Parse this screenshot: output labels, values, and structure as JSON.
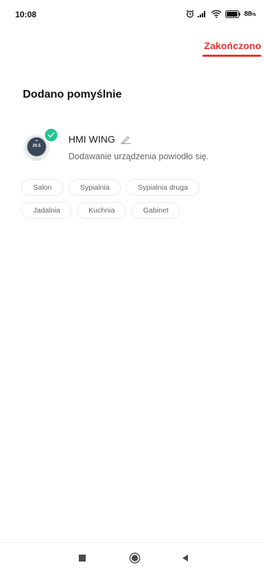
{
  "status_bar": {
    "time": "10:08",
    "battery_percent": "88",
    "battery_suffix": "%",
    "icons": [
      "alarm-icon",
      "signal-icon",
      "wifi-icon",
      "battery-icon"
    ]
  },
  "header": {
    "done_label": "Zakończono",
    "accent_color": "#e5322d"
  },
  "main": {
    "title": "Dodano pomyślnie",
    "device": {
      "name": "HMI WING",
      "status": "Dodawanie urządzenia powiodło się.",
      "display_temperature": "20.5",
      "badge_color": "#1fc68f"
    },
    "rooms": [
      [
        "Salon",
        "Sypialnia",
        "Sypialnia druga"
      ],
      [
        "Jadalnia",
        "Kuchnia",
        "Gabinet"
      ]
    ]
  },
  "nav_bar": {
    "buttons": [
      "recent-apps-icon",
      "home-icon",
      "back-icon"
    ]
  }
}
